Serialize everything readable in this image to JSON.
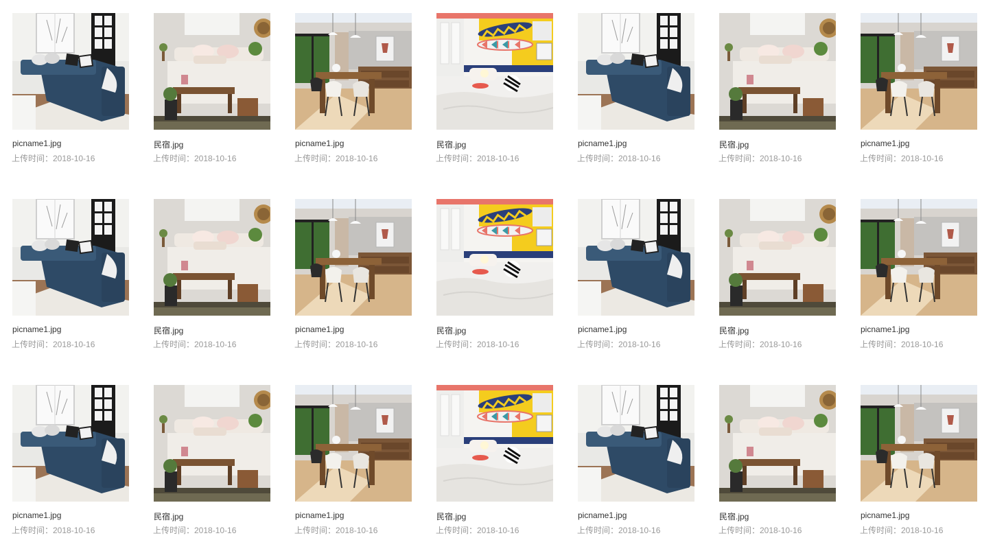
{
  "gallery": {
    "rows": [
      {
        "items": [
          {
            "filename": "picname1.jpg",
            "upload": "上传时间：2018-10-16",
            "scene": "living-room-sofa"
          },
          {
            "filename": "民宿.jpg",
            "upload": "上传时间：2018-10-16",
            "scene": "bedroom-bench"
          },
          {
            "filename": "picname1.jpg",
            "upload": "上传时间：2018-10-16",
            "scene": "dining-room"
          },
          {
            "filename": "民宿.jpg",
            "upload": "上传时间：2018-10-16",
            "scene": "bedroom-surfboards"
          },
          {
            "filename": "picname1.jpg",
            "upload": "上传时间：2018-10-16",
            "scene": "living-room-sofa"
          },
          {
            "filename": "民宿.jpg",
            "upload": "上传时间：2018-10-16",
            "scene": "bedroom-bench"
          },
          {
            "filename": "picname1.jpg",
            "upload": "上传时间：2018-10-16",
            "scene": "dining-room"
          }
        ]
      },
      {
        "items": [
          {
            "filename": "picname1.jpg",
            "upload": "上传时间：2018-10-16",
            "scene": "living-room-sofa"
          },
          {
            "filename": "民宿.jpg",
            "upload": "上传时间：2018-10-16",
            "scene": "bedroom-bench"
          },
          {
            "filename": "picname1.jpg",
            "upload": "上传时间：2018-10-16",
            "scene": "dining-room"
          },
          {
            "filename": "民宿.jpg",
            "upload": "上传时间：2018-10-16",
            "scene": "bedroom-surfboards"
          },
          {
            "filename": "picname1.jpg",
            "upload": "上传时间：2018-10-16",
            "scene": "living-room-sofa"
          },
          {
            "filename": "民宿.jpg",
            "upload": "上传时间：2018-10-16",
            "scene": "bedroom-bench"
          },
          {
            "filename": "picname1.jpg",
            "upload": "上传时间：2018-10-16",
            "scene": "dining-room"
          }
        ]
      },
      {
        "items": [
          {
            "filename": "picname1.jpg",
            "upload": "上传时间：2018-10-16",
            "scene": "living-room-sofa"
          },
          {
            "filename": "民宿.jpg",
            "upload": "上传时间：2018-10-16",
            "scene": "bedroom-bench"
          },
          {
            "filename": "picname1.jpg",
            "upload": "上传时间：2018-10-16",
            "scene": "dining-room"
          },
          {
            "filename": "民宿.jpg",
            "upload": "上传时间：2018-10-16",
            "scene": "bedroom-surfboards"
          },
          {
            "filename": "picname1.jpg",
            "upload": "上传时间：2018-10-16",
            "scene": "living-room-sofa"
          },
          {
            "filename": "民宿.jpg",
            "upload": "上传时间：2018-10-16",
            "scene": "bedroom-bench"
          },
          {
            "filename": "picname1.jpg",
            "upload": "上传时间：2018-10-16",
            "scene": "dining-room"
          }
        ]
      }
    ]
  }
}
